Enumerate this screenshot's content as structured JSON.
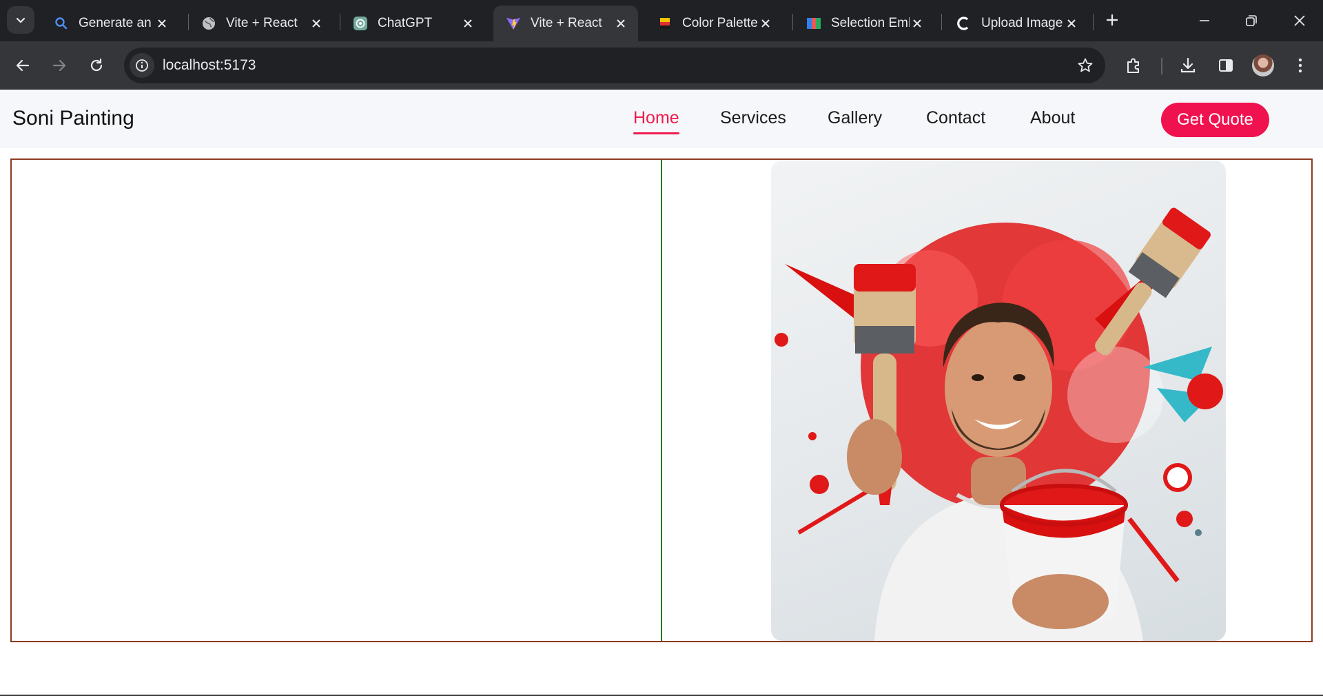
{
  "browser": {
    "tabs": [
      {
        "title": "Generate an in",
        "icon": "search-icon",
        "active": false
      },
      {
        "title": "Vite + React",
        "icon": "globe-icon",
        "active": false
      },
      {
        "title": "ChatGPT",
        "icon": "chatgpt-icon",
        "active": false
      },
      {
        "title": "Vite + React",
        "icon": "vite-icon",
        "active": true
      },
      {
        "title": "Color Palette:",
        "icon": "palette-icon",
        "active": false
      },
      {
        "title": "Selection Emb",
        "icon": "selection-icon",
        "active": false
      },
      {
        "title": "Upload Image",
        "icon": "c-logo-icon",
        "active": false
      }
    ],
    "url": "localhost:5173"
  },
  "site": {
    "brand": "Soni Painting",
    "nav": [
      {
        "label": "Home",
        "active": true
      },
      {
        "label": "Services",
        "active": false
      },
      {
        "label": "Gallery",
        "active": false
      },
      {
        "label": "Contact",
        "active": false
      },
      {
        "label": "About",
        "active": false
      }
    ],
    "cta_label": "Get Quote",
    "accent_color": "#f0114f",
    "hero_image": "smiling painter holding red paintbrush and red paint bucket with red splashes"
  }
}
